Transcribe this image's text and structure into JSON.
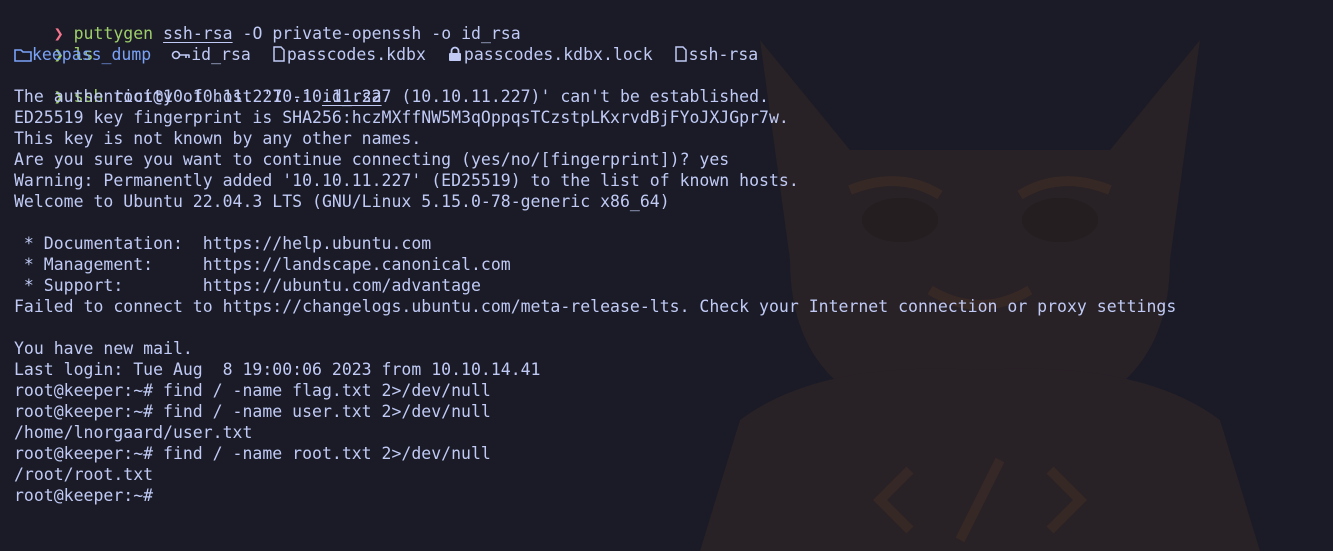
{
  "terminal": {
    "lines": [
      {
        "kind": "cmd",
        "status": "error",
        "program": "puttygen",
        "args_pre": " ",
        "arg_underlined": "ssh-rsa",
        "args_post": " -O private-openssh -o id_rsa"
      },
      {
        "kind": "cmd",
        "status": "ok",
        "program": "ls"
      },
      {
        "kind": "ls"
      },
      {
        "kind": "cmd",
        "status": "ok",
        "program": "ssh",
        "args_pre": " root@10.10.11.227 -i ",
        "arg_underlined": "id_rsa",
        "args_post": ""
      }
    ],
    "ls_items": [
      {
        "name": "keepass_dump",
        "type": "dir",
        "icon": "folder-icon"
      },
      {
        "name": "id_rsa",
        "type": "file",
        "icon": "key-icon"
      },
      {
        "name": "passcodes.kdbx",
        "type": "file",
        "icon": "file-icon"
      },
      {
        "name": "passcodes.kdbx.lock",
        "type": "file",
        "icon": "lock-icon"
      },
      {
        "name": "ssh-rsa",
        "type": "file",
        "icon": "file-icon"
      }
    ],
    "output": [
      "The authenticity of host '10.10.11.227 (10.10.11.227)' can't be established.",
      "ED25519 key fingerprint is SHA256:hczMXffNW5M3qOppqsTCzstpLKxrvdBjFYoJXJGpr7w.",
      "This key is not known by any other names.",
      "Are you sure you want to continue connecting (yes/no/[fingerprint])? yes",
      "Warning: Permanently added '10.10.11.227' (ED25519) to the list of known hosts.",
      "Welcome to Ubuntu 22.04.3 LTS (GNU/Linux 5.15.0-78-generic x86_64)",
      "",
      " * Documentation:  https://help.ubuntu.com",
      " * Management:     https://landscape.canonical.com",
      " * Support:        https://ubuntu.com/advantage",
      "Failed to connect to https://changelogs.ubuntu.com/meta-release-lts. Check your Internet connection or proxy settings",
      "",
      "You have new mail.",
      "Last login: Tue Aug  8 19:00:06 2023 from 10.10.14.41",
      "root@keeper:~# find / -name flag.txt 2>/dev/null",
      "root@keeper:~# find / -name user.txt 2>/dev/null",
      "/home/lnorgaard/user.txt",
      "root@keeper:~# find / -name root.txt 2>/dev/null",
      "/root/root.txt",
      "root@keeper:~#"
    ]
  },
  "colors": {
    "background": "#1a1b26",
    "prompt_ok": "#9ece6a",
    "prompt_error": "#f7768e",
    "directory": "#7aa2f7",
    "text": "#c0caf5"
  }
}
